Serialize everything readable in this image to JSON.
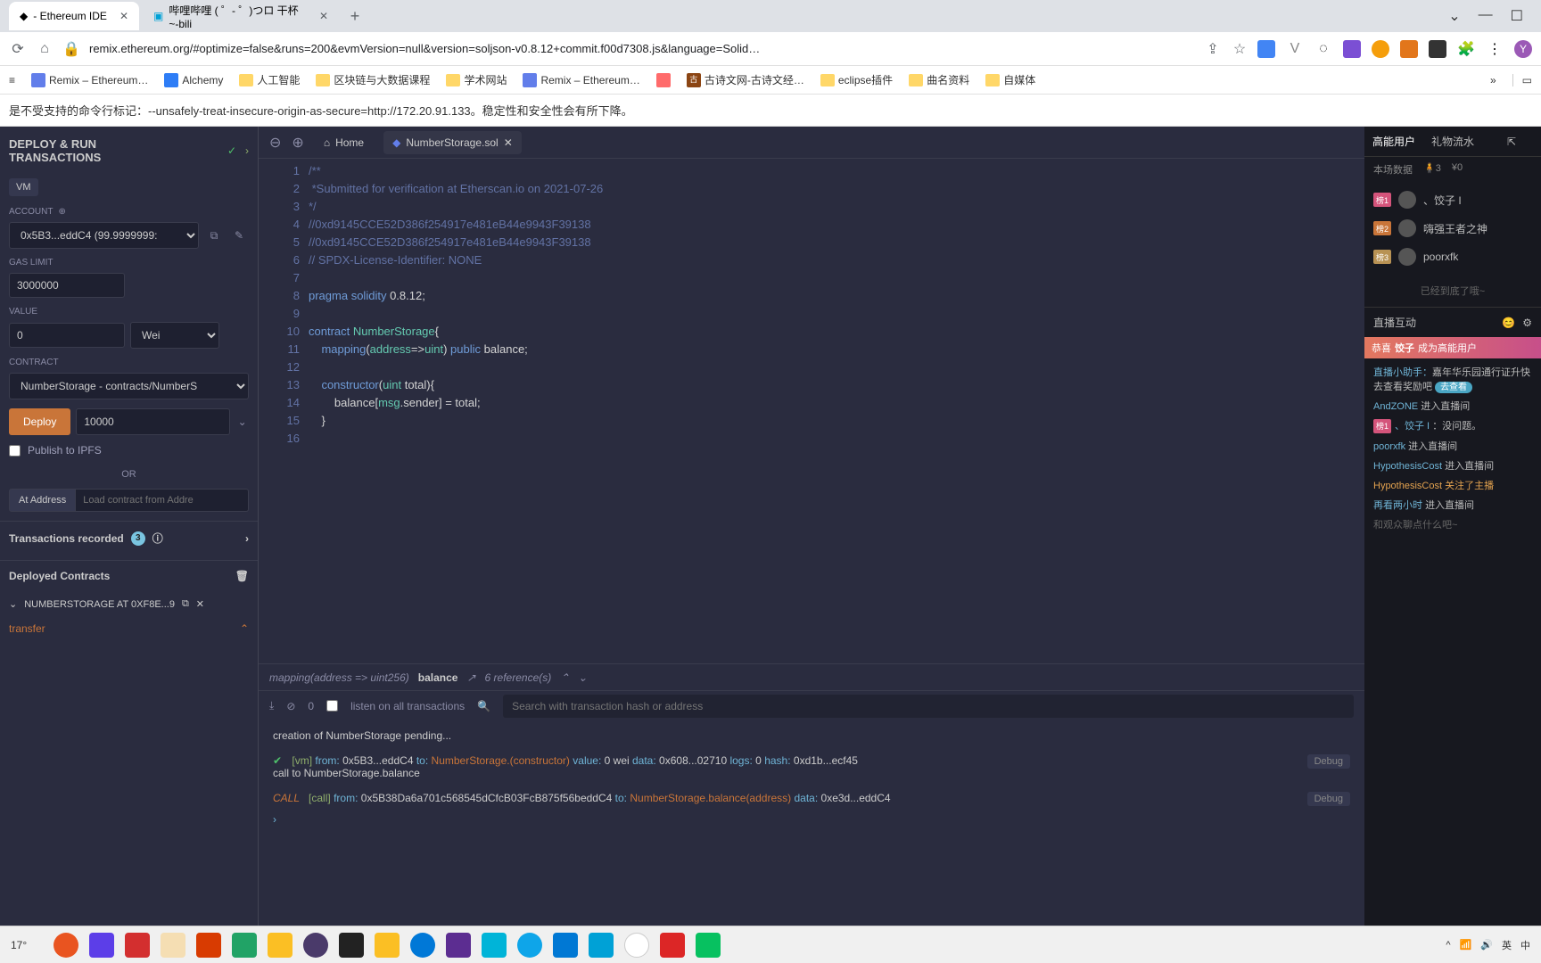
{
  "browser": {
    "tabs": [
      {
        "title": "- Ethereum IDE",
        "icon": "◆"
      },
      {
        "title": "哔哩哔哩 ( ゜- ゜)つロ 干杯~-bili",
        "icon": "▣"
      }
    ],
    "url": "remix.ethereum.org/#optimize=false&runs=200&evmVersion=null&version=soljson-v0.8.12+commit.f00d7308.js&language=Solid…",
    "bookmarks": [
      "Remix – Ethereum…",
      "Alchemy",
      "人工智能",
      "区块链与大数据课程",
      "学术网站",
      "Remix – Ethereum…",
      "古诗文网-古诗文经…",
      "eclipse插件",
      "曲名资料",
      "自媒体"
    ],
    "warning": "是不受支持的命令行标记：--unsafely-treat-insecure-origin-as-secure=http://172.20.91.133。稳定性和安全性会有所下降。"
  },
  "sidebar": {
    "title": "DEPLOY & RUN\nTRANSACTIONS",
    "vm": "VM",
    "account_label": "ACCOUNT",
    "account": "0x5B3...eddC4 (99.9999999:",
    "gas_label": "GAS LIMIT",
    "gas": "3000000",
    "value_label": "VALUE",
    "value": "0",
    "unit": "Wei",
    "contract_label": "CONTRACT",
    "contract": "NumberStorage - contracts/NumberS",
    "deploy": "Deploy",
    "deploy_in": "10000",
    "ipfs": "Publish to IPFS",
    "or": "OR",
    "ataddr": "At Address",
    "ataddr_ph": "Load contract from Addre",
    "txrec": "Transactions recorded",
    "txcount": "3",
    "deployed": "Deployed Contracts",
    "instance": "NUMBERSTORAGE AT 0XF8E...9",
    "transfer": "transfer"
  },
  "editor": {
    "home": "Home",
    "file": "NumberStorage.sol",
    "lines": [
      {
        "n": 1,
        "cls": "c-com",
        "t": "/**"
      },
      {
        "n": 2,
        "cls": "c-com",
        "t": " *Submitted for verification at Etherscan.io on 2021-07-26"
      },
      {
        "n": 3,
        "cls": "c-com",
        "t": "*/"
      },
      {
        "n": 4,
        "cls": "c-com",
        "t": "//0xd9145CCE52D386f254917e481eB44e9943F39138"
      },
      {
        "n": 5,
        "cls": "c-com",
        "t": "//0xd9145CCE52D386f254917e481eB44e9943F39138"
      },
      {
        "n": 6,
        "cls": "c-com",
        "t": "// SPDX-License-Identifier: NONE"
      },
      {
        "n": 7,
        "cls": "",
        "t": ""
      },
      {
        "n": 8,
        "cls": "",
        "t": "<span class='c-key'>pragma</span> <span class='c-key'>solidity</span> <span class='c-text'>0.8.12;</span>"
      },
      {
        "n": 9,
        "cls": "",
        "t": ""
      },
      {
        "n": 10,
        "cls": "",
        "t": "<span class='c-key'>contract</span> <span class='c-type'>NumberStorage</span><span class='c-text'>{</span>"
      },
      {
        "n": 11,
        "cls": "",
        "t": "    <span class='c-key'>mapping</span><span class='c-text'>(</span><span class='c-type'>address</span><span class='c-text'>=></span><span class='c-type'>uint</span><span class='c-text'>)</span> <span class='c-key'>public</span> <span class='c-text'>balance;</span>"
      },
      {
        "n": 12,
        "cls": "",
        "t": "",
        "dot": true
      },
      {
        "n": 13,
        "cls": "",
        "t": "    <span class='c-key'>constructor</span><span class='c-text'>(</span><span class='c-type'>uint</span> <span class='c-text'>total){</span>",
        "dot": true
      },
      {
        "n": 14,
        "cls": "",
        "t": "        <span class='c-text'>balance[</span><span class='c-type'>msg</span><span class='c-text'>.sender] = total;</span>",
        "dot": true
      },
      {
        "n": 15,
        "cls": "",
        "t": "    <span class='c-text'>}</span>",
        "dot": true
      },
      {
        "n": 16,
        "cls": "",
        "t": ""
      }
    ],
    "ref_sig": "mapping(address => uint256)",
    "ref_name": "balance",
    "ref_count": "6 reference(s)"
  },
  "term": {
    "count": "0",
    "listen": "listen on all transactions",
    "search_ph": "Search with transaction hash or address",
    "l1": "creation of NumberStorage pending...",
    "l2_pre": "[vm]",
    "l2_from": "from:",
    "l2_fromv": "0x5B3...eddC4",
    "l2_to": "to:",
    "l2_tov": "NumberStorage.(constructor)",
    "l2_val": "value:",
    "l2_valv": "0 wei",
    "l2_data": "data:",
    "l2_datav": "0x608...02710",
    "l2_logs": "logs:",
    "l2_logsv": "0",
    "l2_hash": "hash:",
    "l2_hashv": "0xd1b...ecf45",
    "l3": "call to NumberStorage.balance",
    "l4_pre": "CALL",
    "l4_call": "[call]",
    "l4_from": "from:",
    "l4_fromv": "0x5B38Da6a701c568545dCfcB03FcB875f56beddC4",
    "l4_to": "to:",
    "l4_tov": "NumberStorage.balance(address)",
    "l4_data": "data:",
    "l4_datav": "0xe3d...eddC4",
    "debug": "Debug"
  },
  "overlay": {
    "tab1": "高能用户",
    "tab2": "礼物流水",
    "stat1": "本场数据",
    "stat2": "🧍3",
    "stat3": "¥0",
    "users": [
      {
        "rank": "榜1",
        "name": "、饺子 I"
      },
      {
        "rank": "榜2",
        "name": "嗨强王者之神"
      },
      {
        "rank": "榜3",
        "name": "poorxfk"
      }
    ],
    "end": "已经到底了哦~",
    "sec_title": "直播互动",
    "banner_k": "恭喜",
    "banner_u": "饺子",
    "banner_t": "成为高能用户",
    "ann_k": "直播小助手：",
    "ann_t": "嘉年华乐园通行证升快去查看奖励吧",
    "ann_btn": "去查看",
    "chat": [
      {
        "u": "AndZONE",
        "t": "进入直播间"
      },
      {
        "u": "、饺子 I",
        "t": "：没问题。",
        "rank": "榜1"
      },
      {
        "u": "poorxfk",
        "t": "进入直播间"
      },
      {
        "u": "HypothesisCost",
        "t": "进入直播间"
      },
      {
        "u": "HypothesisCost",
        "t": "关注了主播",
        "hl": true
      },
      {
        "u": "再看两小时",
        "t": "进入直播间"
      },
      {
        "u": "",
        "t": "和观众聊点什么吧~",
        "sys": true
      }
    ]
  },
  "taskbar": {
    "temp": "17°",
    "tray": [
      "^",
      "📶",
      "🔊",
      "英",
      "中"
    ]
  }
}
